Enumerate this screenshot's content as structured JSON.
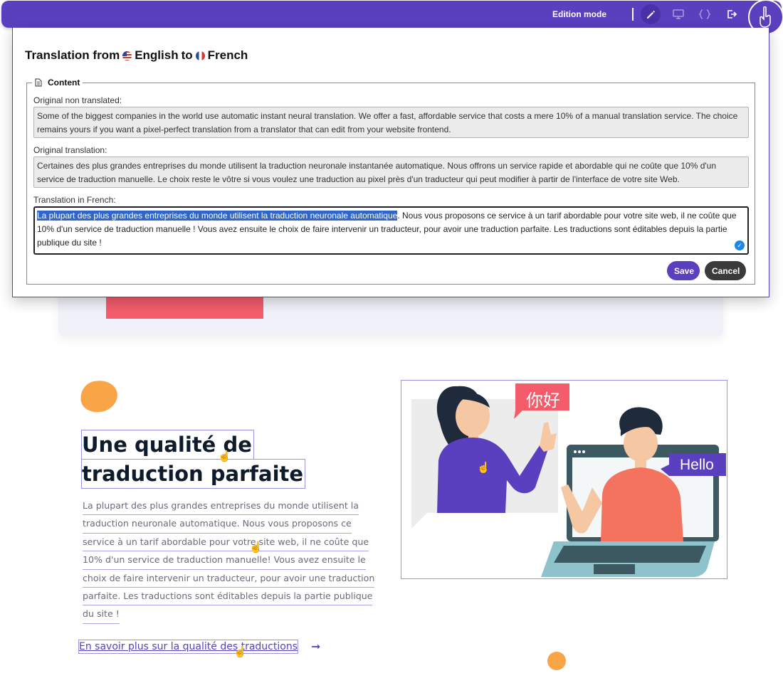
{
  "toolbar": {
    "mode_label": "Edition mode",
    "tools": [
      "pencil-icon",
      "monitor-icon",
      "code-icon",
      "exit-icon"
    ],
    "accent_color": "#5a3fbf"
  },
  "modal": {
    "title_prefix": "Translation from",
    "source_language": "English",
    "title_middle": "to",
    "target_language": "French",
    "fieldset_legend": "Content",
    "original_label": "Original non translated:",
    "original_text": "Some of the biggest companies in the world use automatic instant neural translation. We offer a fast, affordable service that costs a mere 10% of a manual translation service. The choice remains yours if you want a pixel-perfect translation from a translator that can edit from your website frontend.",
    "machine_label": "Original translation:",
    "machine_text": "Certaines des plus grandes entreprises du monde utilisent la traduction neuronale instantanée automatique. Nous offrons un service rapide et abordable qui ne coûte que 10% d'un service de traduction manuelle. Le choix reste le vôtre si vous voulez une traduction au pixel près d'un traducteur qui peut modifier à partir de l'interface de votre site Web.",
    "translation_label": "Translation in French:",
    "translation_selected": "La plupart des plus grandes entreprises du monde utilisent la traduction neuronale automatique",
    "translation_rest": ". Nous vous proposons ce service à un tarif abordable pour votre site web, il ne coûte que 10% d'un service de traduction manuelle ! Vous avez ensuite le choix de faire intervenir un traducteur, pour avoir une traduction parfaite. Les traductions sont éditables depuis la partie publique du site !",
    "save_label": "Save",
    "cancel_label": "Cancel"
  },
  "page": {
    "headline_lines": [
      "Une qualité de",
      "traduction parfaite"
    ],
    "body_lines": [
      "La plupart des plus grandes entreprises du monde utilisent la",
      "traduction neuronale automatique. Nous vous proposons ce",
      "service à un tarif abordable pour votre site web, il ne coûte que",
      "10% d'un service de traduction manuelle! Vous avez ensuite le",
      "choix de faire intervenir un traducteur, pour avoir une traduction",
      "parfaite. Les traductions sont éditables depuis la partie publique",
      "du site !"
    ],
    "link_label": "En savoir plus sur la qualité des traductions",
    "link_arrow": "➞",
    "illustration": {
      "bubble_chinese": "你好",
      "bubble_english": "Hello"
    }
  }
}
